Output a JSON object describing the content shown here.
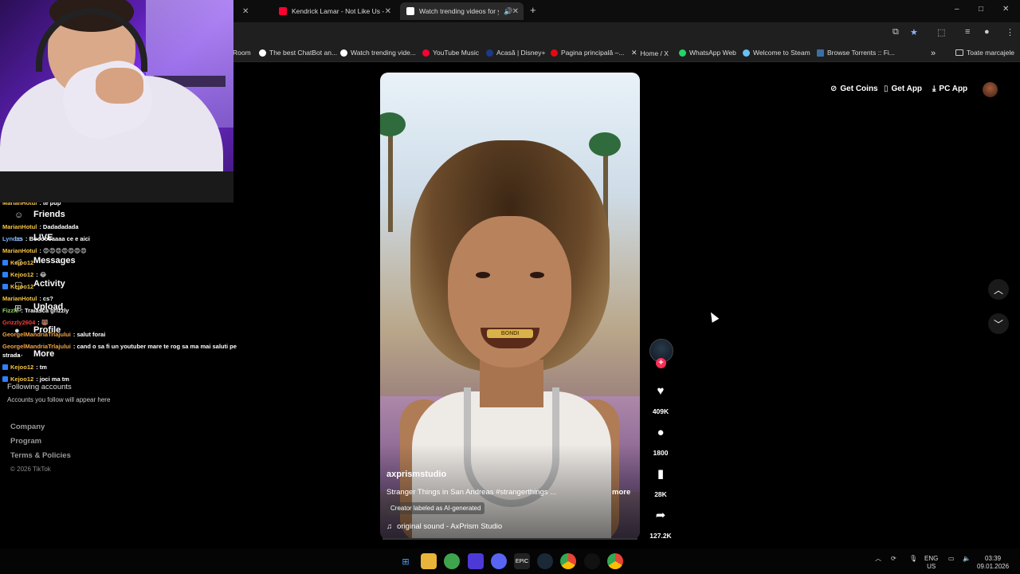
{
  "browser": {
    "tabs": [
      {
        "label": "Kendrick Lamar - Not Like Us -",
        "favicon_color": "#ff0033",
        "active": false
      },
      {
        "label": "Watch trending videos for y",
        "favicon_color": "#ffffff",
        "active": true
      }
    ],
    "new_tab": "+",
    "window_controls": {
      "minimize": "–",
      "maximize": "□",
      "close": "✕"
    },
    "bookmarks": [
      {
        "label": "Room",
        "icon_color": "#888888"
      },
      {
        "label": "The best ChatBot an...",
        "icon_color": "#ffffff"
      },
      {
        "label": "Watch trending vide...",
        "icon_color": "#ffffff"
      },
      {
        "label": "YouTube Music",
        "icon_color": "#ff0033"
      },
      {
        "label": "Acasă | Disney+",
        "icon_color": "#1b3a8a"
      },
      {
        "label": "Pagina principală –...",
        "icon_color": "#e50914"
      },
      {
        "label": "Home / X",
        "icon_color": "#ffffff"
      },
      {
        "label": "WhatsApp Web",
        "icon_color": "#25d366"
      },
      {
        "label": "Welcome to Steam",
        "icon_color": "#66c0f4"
      },
      {
        "label": "Browse Torrents :: Fi...",
        "icon_color": "#3a6ea5"
      }
    ],
    "bookmarks_overflow": "»",
    "all_bookmarks": "Toate marcajele"
  },
  "chat": [
    {
      "user": "MarianHotul",
      "msg": ": te pup",
      "color": "#f5c542",
      "badge": false
    },
    {
      "user": "MarianHotul",
      "msg": ": Dadadadada",
      "color": "#f5c542",
      "badge": false
    },
    {
      "user": "Lyndas",
      "msg": ": Boooooaaaa ce e aici",
      "color": "#7fb3ff",
      "badge": false
    },
    {
      "user": "MarianHotul",
      "msg": ": 😍😍😍😍😍😍😍",
      "color": "#f5c542",
      "badge": false
    },
    {
      "user": "Kejoo12",
      "msg": ": 😂",
      "color": "#f5c542",
      "badge": true
    },
    {
      "user": "Kejoo12",
      "msg": ": cs?",
      "color": "#f5c542",
      "badge": true
    },
    {
      "user": "MarianHotul",
      "msg": ": cs?",
      "color": "#f5c542",
      "badge": false
    },
    {
      "user": "Fizzle",
      "msg": ": Traiasca grizzly",
      "color": "#8fd16a",
      "badge": false
    },
    {
      "user": "Grizzly2604",
      "msg": ": 🐻",
      "color": "#ff3b3b",
      "badge": false
    },
    {
      "user": "GeorgelMandriaTrlajului",
      "msg": ": salut forai",
      "color": "#f5a442",
      "badge": false
    },
    {
      "user": "GeorgelMandriaTrlajului",
      "msg": ": cand o sa fi un youtuber mare te rog sa ma mai saluti pe",
      "color": "#f5a442",
      "badge": false
    },
    {
      "user": "",
      "msg": "strada",
      "color": "#ffffff",
      "badge": false
    },
    {
      "user": "Kejoo12",
      "msg": ": tm",
      "color": "#f5c542",
      "badge": true
    },
    {
      "user": "Kejoo12",
      "msg": ": joci ma tm",
      "color": "#f5c542",
      "badge": true
    }
  ],
  "sidebar": {
    "items": [
      {
        "label": "Friends",
        "icon": "friends-icon"
      },
      {
        "label": "LIVE",
        "icon": "live-icon"
      },
      {
        "label": "Messages",
        "icon": "messages-icon"
      },
      {
        "label": "Activity",
        "icon": "activity-icon"
      },
      {
        "label": "Upload",
        "icon": "upload-icon"
      },
      {
        "label": "Profile",
        "icon": "profile-icon"
      },
      {
        "label": "More",
        "icon": "more-icon"
      }
    ],
    "following_title": "Following accounts",
    "following_sub": "Accounts you follow will appear here",
    "footer_links": [
      "Company",
      "Program",
      "Terms & Policies"
    ],
    "copyright": "© 2026 TikTok"
  },
  "header": {
    "get_coins": "Get Coins",
    "get_app": "Get App",
    "pc_app": "PC App"
  },
  "video": {
    "author": "axprismstudio",
    "caption": "Stranger Things in San Andreas #strangerthings ...",
    "more": "more",
    "ai_label": "Creator labeled as AI-generated",
    "sound": "original sound - AxPrism Studio",
    "teeth_text": "BONDI",
    "likes": "409K",
    "comments": "1800",
    "saves": "28K",
    "shares": "127.2K"
  },
  "taskbar": {
    "lang_top": "ENG",
    "lang_bottom": "US",
    "time": "03:39",
    "date": "09.01.2026"
  },
  "colors": {
    "tiktok_red": "#fe2c55",
    "page_bg": "#000000"
  }
}
